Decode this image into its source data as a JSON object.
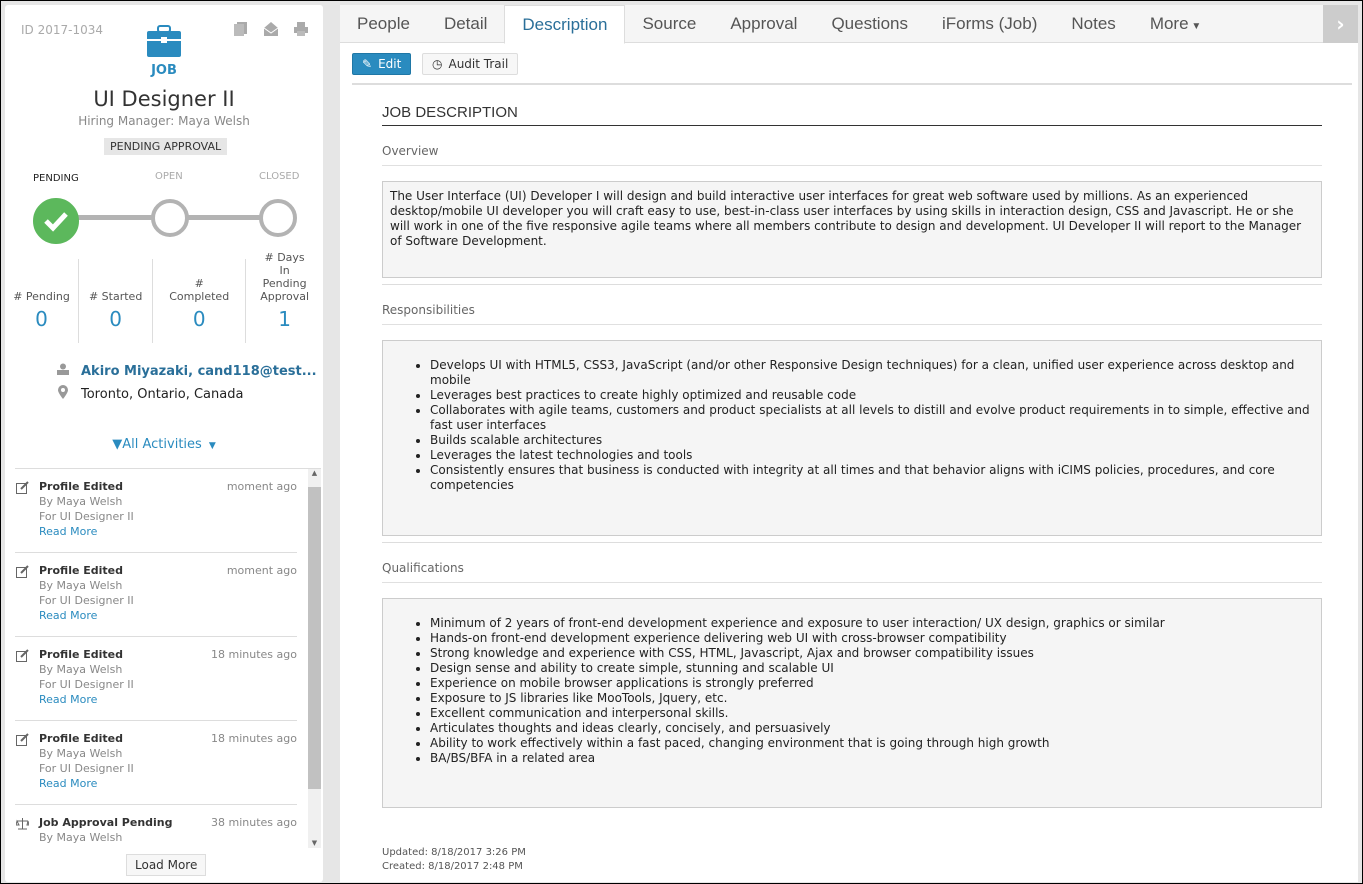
{
  "job": {
    "id": "ID 2017-1034",
    "type": "JOB",
    "title": "UI Designer II",
    "hiring_manager": "Hiring Manager: Maya Welsh",
    "status": "PENDING APPROVAL"
  },
  "steps": [
    {
      "label": "PENDING",
      "done": true
    },
    {
      "label": "OPEN",
      "done": false
    },
    {
      "label": "CLOSED",
      "done": false
    }
  ],
  "stats": [
    {
      "label": "# Pending",
      "value": "0"
    },
    {
      "label": "# Started",
      "value": "0"
    },
    {
      "label": "# Completed",
      "value": "0"
    },
    {
      "label": "# Days In Pending Approval",
      "value": "1"
    }
  ],
  "contact": {
    "person": "Akiro Miyazaki, cand118@test...",
    "location": "Toronto, Ontario, Canada"
  },
  "activities_filter": "All Activities",
  "activities": [
    {
      "title": "Profile Edited",
      "time": "moment ago",
      "by": "By Maya Welsh",
      "for": "For UI Designer II",
      "more": "Read More",
      "icon": "edit-icon"
    },
    {
      "title": "Profile Edited",
      "time": "moment ago",
      "by": "By Maya Welsh",
      "for": "For UI Designer II",
      "more": "Read More",
      "icon": "edit-icon"
    },
    {
      "title": "Profile Edited",
      "time": "18 minutes ago",
      "by": "By Maya Welsh",
      "for": "For UI Designer II",
      "more": "Read More",
      "icon": "edit-icon"
    },
    {
      "title": "Profile Edited",
      "time": "18 minutes ago",
      "by": "By Maya Welsh",
      "for": "For UI Designer II",
      "more": "Read More",
      "icon": "edit-icon"
    },
    {
      "title": "Job Approval Pending",
      "time": "38 minutes ago",
      "by": "By Maya Welsh",
      "icon": "scale-icon"
    }
  ],
  "load_more": "Load More",
  "tabs": [
    "People",
    "Detail",
    "Description",
    "Source",
    "Approval",
    "Questions",
    "iForms (Job)",
    "Notes",
    "More"
  ],
  "active_tab": "Description",
  "toolbar": {
    "edit": "Edit",
    "audit": "Audit Trail"
  },
  "description": {
    "heading": "JOB DESCRIPTION",
    "overview_label": "Overview",
    "overview": "The User Interface (UI) Developer I will design and build interactive user interfaces for great web software used by millions. As an experienced desktop/mobile UI developer you will craft easy to use, best-in-class user interfaces by using skills in interaction design, CSS and Javascript. He or she will work in one of the five responsive agile teams where all members contribute to design and development. UI Developer II will report to the Manager of Software Development.",
    "responsibilities_label": "Responsibilities",
    "responsibilities": [
      "Develops UI with HTML5, CSS3, JavaScript (and/or other Responsive Design techniques) for a clean, unified user experience across desktop and mobile",
      "Leverages best practices to create highly optimized and reusable code",
      "Collaborates with agile teams, customers and product specialists at all levels to distill and evolve product requirements in to simple, effective and fast user interfaces",
      "Builds scalable architectures",
      "Leverages the latest technologies and tools",
      "Consistently ensures that business is conducted with integrity at all times and that behavior aligns with iCIMS policies, procedures, and core competencies"
    ],
    "qualifications_label": "Qualifications",
    "qualifications": [
      "Minimum of 2 years of front-end development experience and exposure to user interaction/ UX design, graphics or similar",
      "Hands-on front-end development experience delivering web UI with cross-browser compatibility",
      "Strong knowledge and experience with CSS, HTML, Javascript, Ajax and browser compatibility issues",
      "Design sense and ability to create simple, stunning and scalable UI",
      "Experience on mobile browser applications is strongly preferred",
      "Exposure to JS libraries like MooTools, Jquery, etc.",
      "Excellent communication and interpersonal skills.",
      "Articulates thoughts and ideas clearly, concisely, and persuasively",
      "Ability to work effectively within a fast paced, changing environment that is going through high growth",
      "BA/BS/BFA in a related area"
    ]
  },
  "footer": {
    "updated": "Updated: 8/18/2017 3:26 PM",
    "created": "Created: 8/18/2017 2:48 PM"
  },
  "colors": {
    "accent": "#2a8bbf",
    "success": "#5cb85c"
  }
}
